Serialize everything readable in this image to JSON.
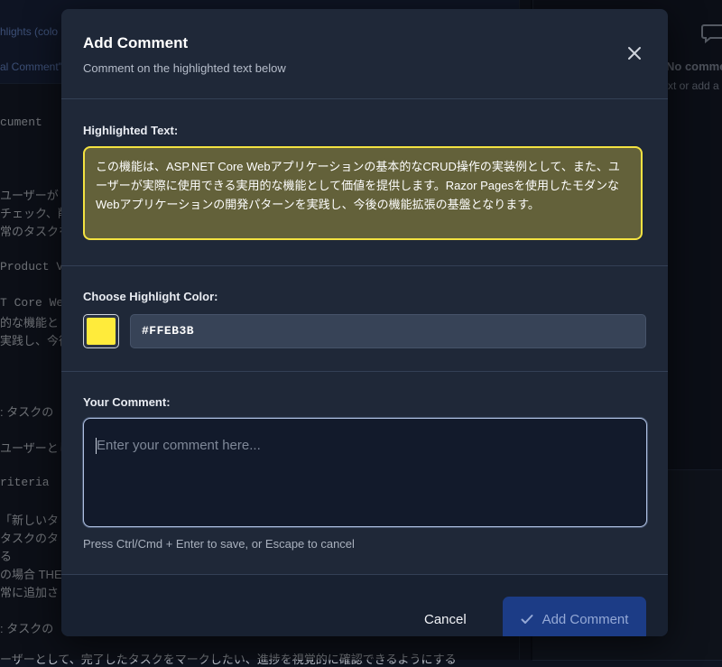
{
  "background": {
    "banner_lines": [
      "hlights (colo",
      "al Comment\""
    ],
    "doc_lines": [
      {
        "text": "cument",
        "mono": true
      },
      {
        "text": "ユーザーが",
        "mono": false
      },
      {
        "text": "チェック、削",
        "mono": false
      },
      {
        "text": "常のタスクを",
        "mono": false
      },
      {
        "text": "Product V",
        "mono": true
      },
      {
        "text": "T Core Web",
        "mono": true
      },
      {
        "text": "的な機能とし",
        "mono": false
      },
      {
        "text": "実践し、今後",
        "mono": false
      },
      {
        "text": ": タスクの",
        "mono": false
      },
      {
        "text": "ユーザーとし",
        "mono": false
      },
      {
        "text": "riteria",
        "mono": true
      },
      {
        "text": "「新しいタ",
        "mono": false
      },
      {
        "text": "タスクのタ",
        "mono": false
      },
      {
        "text": "る",
        "mono": false
      },
      {
        "text": "の場合 THE",
        "mono": false
      },
      {
        "text": "常に追加さ",
        "mono": false
      },
      {
        "text": ": タスクの",
        "mono": false
      },
      {
        "text": "ーザーとして、完了したタスクをマークしたい、進捗を視覚的に確認できるようにする",
        "mono": false
      }
    ],
    "right_panel": {
      "heading": "No comme",
      "subtext": "xt or add a"
    }
  },
  "modal": {
    "title": "Add Comment",
    "subtitle": "Comment on the highlighted text below",
    "highlighted_label": "Highlighted Text:",
    "highlighted_text": "この機能は、ASP.NET Core Webアプリケーションの基本的なCRUD操作の実装例として、また、ユーザーが実際に使用できる実用的な機能として価値を提供します。Razor Pagesを使用したモダンなWebアプリケーションの開発パターンを実践し、今後の機能拡張の基盤となります。",
    "color_label": "Choose Highlight Color:",
    "color_value": "#FFEB3B",
    "comment_label": "Your Comment:",
    "comment_placeholder": "Enter your comment here...",
    "comment_value": "",
    "hint": "Press Ctrl/Cmd + Enter to save, or Escape to cancel",
    "cancel_label": "Cancel",
    "add_label": "Add Comment"
  },
  "colors": {
    "highlight": "#FFEB3B",
    "accent": "#1c3c86"
  },
  "icons": {
    "close": "close-icon",
    "check": "check-icon",
    "comment": "comment-bubble-icon"
  }
}
